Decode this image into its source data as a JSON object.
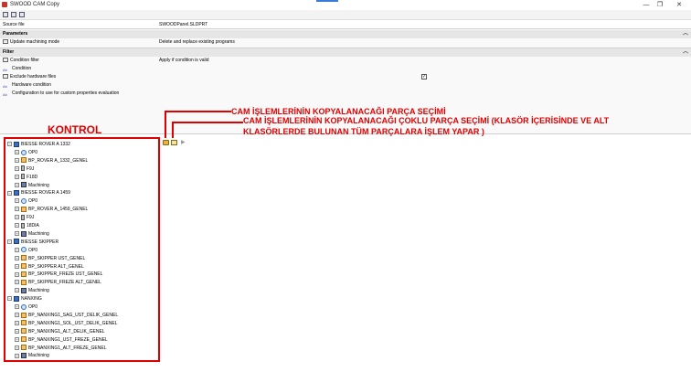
{
  "window": {
    "title": "SWOOD CAM Copy",
    "minimize": "—",
    "restore": "❐",
    "close": "✕"
  },
  "grid": {
    "source_file": {
      "key": "Source file",
      "value": "SWOODPanel.SLDPRT"
    },
    "parameters_header": "Parameters",
    "update_mode": {
      "key": "Update machining mode",
      "value": "Delete and replace existing programs"
    },
    "filter_header": "Filter",
    "condition_filter": {
      "key": "Condition filter",
      "value": "Apply if condition is valid"
    },
    "condition": {
      "key": "Condition"
    },
    "exclude_hardware": {
      "key": "Exclude hardware files",
      "checked": "✓"
    },
    "hardware_condition": {
      "key": "Hardware condition"
    },
    "configuration": {
      "key": "Configuration to use for custom properties evaluation"
    }
  },
  "annotations": {
    "single_part": "CAM İŞLEMLERİNİN KOPYALANACAĞI PARÇA SEÇİMİ",
    "multi_part_line1": "CAM İŞLEMLERİNİN KOPYALANACAĞI ÇOKLU PARÇA SEÇİMİ (KLASÖR İÇERİSİNDE VE ALT",
    "multi_part_line2": "KLASÖRLERDE BULUNAN TÜM PARÇALARA İŞLEM YAPAR )",
    "kontrol": "KONTROL"
  },
  "tree": [
    {
      "label": "BIESSE ROVER A 1332",
      "type": "machine",
      "level": 0
    },
    {
      "label": "OP0",
      "type": "op",
      "level": 1
    },
    {
      "label": "BP_ROVER A_1332_GENEL",
      "type": "part",
      "level": 1
    },
    {
      "label": "F9J",
      "type": "tool",
      "level": 1
    },
    {
      "label": "F18D",
      "type": "tool",
      "level": 1
    },
    {
      "label": "Machining",
      "type": "mach",
      "level": 1
    },
    {
      "label": "BIESSE ROVER A 1459",
      "type": "machine",
      "level": 0
    },
    {
      "label": "OP0",
      "type": "op",
      "level": 1
    },
    {
      "label": "BP_ROVER A_1459_GENEL",
      "type": "part",
      "level": 1
    },
    {
      "label": "F9J",
      "type": "tool",
      "level": 1
    },
    {
      "label": "18DIA",
      "type": "tool",
      "level": 1
    },
    {
      "label": "Machining",
      "type": "mach",
      "level": 1
    },
    {
      "label": "BIESSE SKIPPER",
      "type": "machine",
      "level": 0
    },
    {
      "label": "OP0",
      "type": "op",
      "level": 1
    },
    {
      "label": "BP_SKIPPER UST_GENEL",
      "type": "part",
      "level": 1
    },
    {
      "label": "BP_SKIPPER ALT_GENEL",
      "type": "part",
      "level": 1
    },
    {
      "label": "BP_SKIPPER_FREZE UST_GENEL",
      "type": "part",
      "level": 1
    },
    {
      "label": "BP_SKIPPER_FREZE ALT_GENEL",
      "type": "part",
      "level": 1
    },
    {
      "label": "Machining",
      "type": "mach",
      "level": 1
    },
    {
      "label": "NANXING",
      "type": "machine",
      "level": 0
    },
    {
      "label": "OP0",
      "type": "op",
      "level": 1
    },
    {
      "label": "BP_NANXING1_SAG_UST_DELIK_GENEL",
      "type": "part",
      "level": 1
    },
    {
      "label": "BP_NANXING1_SOL_UST_DELIK_GENEL",
      "type": "part",
      "level": 1
    },
    {
      "label": "BP_NANXING1_ALT_DELIK_GENEL",
      "type": "part",
      "level": 1
    },
    {
      "label": "BP_NANXING1_UST_FREZE_GENEL",
      "type": "part",
      "level": 1
    },
    {
      "label": "BP_NANXING1_ALT_FREZE_GENEL",
      "type": "part",
      "level": 1
    },
    {
      "label": "Machining",
      "type": "mach",
      "level": 1
    }
  ]
}
